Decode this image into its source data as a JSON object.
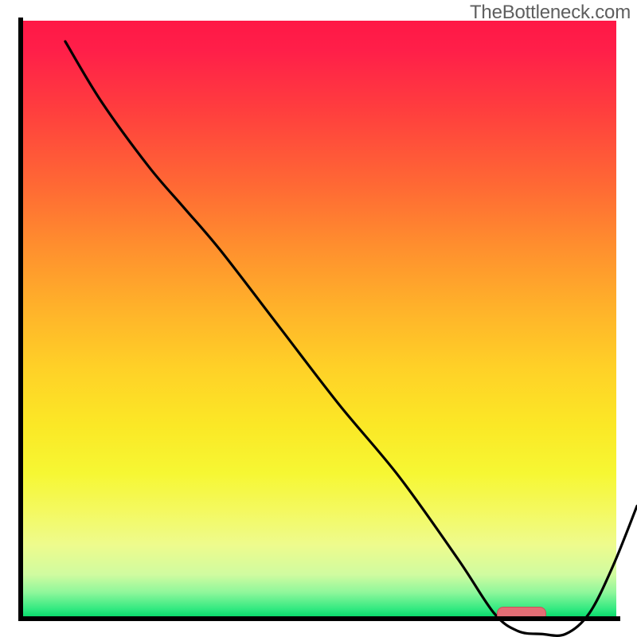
{
  "watermark": "TheBottleneck.com",
  "chart_data": {
    "type": "line",
    "title": "",
    "xlabel": "",
    "ylabel": "",
    "xlim": [
      0,
      100
    ],
    "ylim": [
      0,
      100
    ],
    "grid": false,
    "legend": false,
    "background_gradient": {
      "direction": "vertical",
      "stops": [
        {
          "pos": 0,
          "color": "#ff1846",
          "meaning": "high-bottleneck"
        },
        {
          "pos": 50,
          "color": "#ffb12a",
          "meaning": "medium"
        },
        {
          "pos": 80,
          "color": "#f6f733",
          "meaning": "low"
        },
        {
          "pos": 100,
          "color": "#0bdc6c",
          "meaning": "optimal"
        }
      ]
    },
    "series": [
      {
        "name": "bottleneck-curve",
        "color": "#000000",
        "x": [
          4,
          10,
          18,
          24,
          30,
          40,
          50,
          60,
          70,
          76,
          80,
          84,
          88,
          92,
          96,
          100
        ],
        "y": [
          100,
          90,
          79,
          72,
          65,
          52,
          39,
          27,
          13,
          4,
          1,
          0.5,
          0.5,
          4,
          12,
          22
        ]
      }
    ],
    "marker": {
      "name": "optimal-range-marker",
      "color": "#e26d74",
      "x_range": [
        80,
        88
      ],
      "y": 0.5
    }
  }
}
